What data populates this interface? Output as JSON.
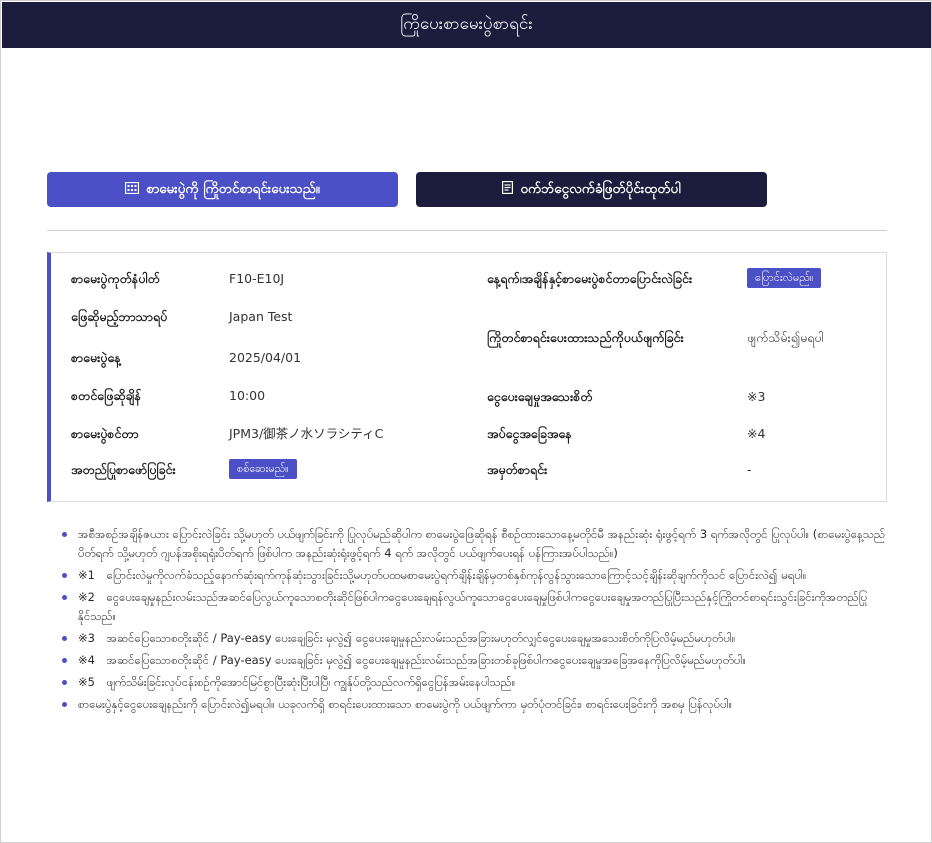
{
  "header": {
    "title": "ကြိုပေးစာမေးပွဲစာရင်း"
  },
  "actions": {
    "apply_label": "စာမေးပွဲကို ကြိုတင်စာရင်းပေးသည်။",
    "apply_icon": "calendar-grid-icon",
    "print_label": "ဝက်ဘ်ငွေလက်ခံဖြတ်ပိုင်းထုတ်ပါ",
    "print_icon": "document-icon"
  },
  "info": {
    "left": [
      {
        "label": "စာမေးပွဲကုတ်နံပါတ်",
        "value": "F10-E10J"
      },
      {
        "label": "ဖြေဆိုမည့်ဘာသာရပ်",
        "value": "Japan Test"
      },
      {
        "label": "စာမေးပွဲနေ့",
        "value": "2025/04/01"
      },
      {
        "label": "စတင်ဖြေဆိုချိန်",
        "value": "10:00"
      },
      {
        "label": "စာမေးပွဲစင်တာ",
        "value": "JPM3/御茶ノ水ソラシティC"
      },
      {
        "label": "အတည်ပြုစာဖော်ပြခြင်း",
        "value": "",
        "button": "စစ်ဆေးမည်။"
      }
    ],
    "right": [
      {
        "label": "နေ့ရက်၊အချိန်နှင့်စာမေးပွဲစင်တာပြောင်းလဲခြင်း",
        "value": "",
        "button": "ပြောင်းလဲမည်။"
      },
      {
        "label": "ကြိုတင်စာရင်းပေးထားသည်ကိုပယ်ဖျက်ခြင်း",
        "value": "ဖျက်သိမ်း၍မရပါ"
      },
      {
        "label": "ငွေပေးချေမှုအသေးစိတ်",
        "value": "※3"
      },
      {
        "label": "အပ်ငွေအခြေအနေ",
        "value": "※4"
      },
      {
        "label": "အမှတ်စာရင်း",
        "value": "-"
      }
    ]
  },
  "notes": [
    "အစီအစဉ်အချိန်ဇယား ပြောင်းလဲခြင်း သို့မဟုတ် ပယ်ဖျက်ခြင်းကို ပြုလုပ်မည်ဆိုပါက စာမေးပွဲဖြေဆိုရန် စီစဉ်ထားသောနေ့မတိုင်မီ အနည်းဆုံး ရုံးဖွင့်ရက် 3 ရက်အလိုတွင် ပြုလုပ်ပါ။ (စာမေးပွဲနေ့သည် ပိတ်ရက် သို့မဟုတ် ဂျပန်အစိုးရရုံးပိတ်ရက် ဖြစ်ပါက အနည်းဆုံးရုံးဖွင့်ရက် 4 ရက် အလိုတွင် ပယ်ဖျက်ပေးရန် ပန်ကြားအပ်ပါသည်။)",
    "※1　ပြောင်းလဲမှုကိုလက်ခံသည့်နောက်ဆုံးရက်ကုန်ဆုံးသွားခြင်းသို့မဟုတ်ပထမစာမေးပွဲရက်ချိန်းချိန်မှတစ်နှစ်ကုန်လွန်သွားသောကြောင့်သင့်ချိန်းဆိုချက်ကိုသင် ပြောင်းလဲ၍ မရပါ။",
    "※2　ငွေပေးချေမှုနည်းလမ်းသည်အဆင်ပြေလွယ်ကူသောစတိုးဆိုင်ဖြစ်ပါကငွေပေးချေရန်လွယ်ကူသောငွေပေးချေမှုဖြစ်ပါကငွေပေးချေမှုအတည်ပြုပြီးသည်နှင့်ကြိုတင်စာရင်းသွင်းခြင်းကိုအတည်ပြုနိုင်သည်။",
    "※3　အဆင်ပြေသောစတိုးဆိုင် / Pay-easy ပေးချေခြင်း မှလွဲ၍ ငွေပေးချေမှုနည်းလမ်းသည်အခြားမဟုတ်လျှင်ငွေပေးချေမှုအသေးစိတ်ကိုပြလိမ့်မည်မဟုတ်ပါ။",
    "※4　အဆင်ပြေသောစတိုးဆိုင် / Pay-easy ပေးချေခြင်း မှလွဲ၍ ငွေပေးချေမှုနည်းလမ်းသည်အခြားတစ်ခုဖြစ်ပါကငွေပေးချေမှုအခြေအနေကိုပြလိမ့်မည်မဟုတ်ပါ။",
    "※5　ဖျက်သိမ်းခြင်းလုပ်ငန်းစဉ်ကိုအောင်မြင်စွာပြီးဆုံးပြီးပါပြီ၊ ကျွန်ုပ်တို့သည်လက်ရှိငွေပြန်အမ်းနေပါသည်။",
    "စာမေးပွဲနှင့်ငွေပေးချေနည်းကို ပြောင်းလဲ၍မရပါ။ ယခုလက်ရှိ စာရင်းပေးထားသော စာမေးပွဲကို ပယ်ဖျက်ကာ မှတ်ပုံတင်ခြင်း၊ စာရင်းပေးခြင်းကို အစမှ ပြန်လုပ်ပါ။"
  ]
}
